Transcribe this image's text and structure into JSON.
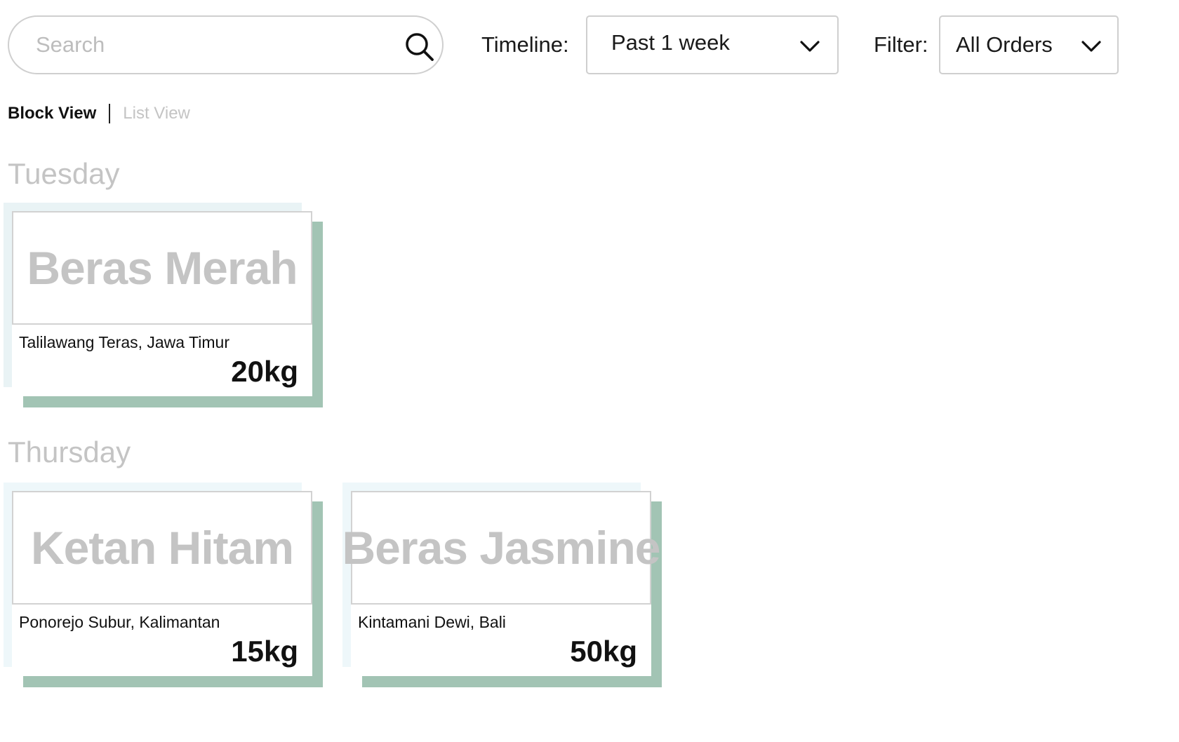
{
  "search": {
    "placeholder": "Search",
    "value": ""
  },
  "timeline": {
    "label": "Timeline:",
    "selected": "Past 1 week"
  },
  "filter": {
    "label": "Filter:",
    "selected": "All Orders"
  },
  "view_toggle": {
    "active": "Block View",
    "inactive": "List View"
  },
  "days": [
    {
      "name": "Tuesday",
      "orders": [
        {
          "product": "Beras Merah",
          "location": "Talilawang Teras, Jawa Timur",
          "weight": "20kg"
        }
      ]
    },
    {
      "name": "Thursday",
      "orders": [
        {
          "product": "Ketan Hitam",
          "location": "Ponorejo Subur, Kalimantan",
          "weight": "15kg"
        },
        {
          "product": "Beras Jasmine",
          "location": "Kintamani Dewi, Bali",
          "weight": "50kg"
        }
      ]
    }
  ],
  "colors": {
    "card_shadow": "#a2c4b4",
    "card_backdrop": "#e9f3f5",
    "muted_text": "#c4c4c4",
    "border": "#cfcfcf"
  },
  "icons": {
    "search": "search-icon",
    "dropdown": "chevron-down-icon"
  }
}
